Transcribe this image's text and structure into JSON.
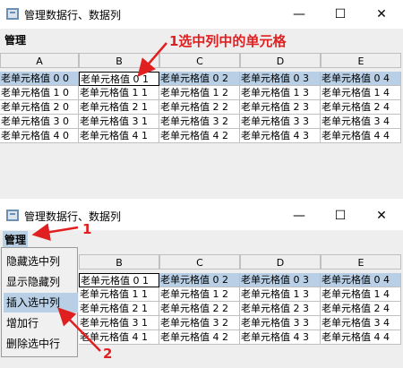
{
  "window1": {
    "title": "管理数据行、数据列",
    "menu": "管理",
    "controls": [
      "—",
      "☐",
      "✕"
    ],
    "columns": [
      "A",
      "B",
      "C",
      "D",
      "E"
    ],
    "rows": [
      [
        "老单元格值 0 0",
        "老单元格值 0 1",
        "老单元格值 0 2",
        "老单元格值 0 3",
        "老单元格值 0 4"
      ],
      [
        "老单元格值 1 0",
        "老单元格值 1 1",
        "老单元格值 1 2",
        "老单元格值 1 3",
        "老单元格值 1 4"
      ],
      [
        "老单元格值 2 0",
        "老单元格值 2 1",
        "老单元格值 2 2",
        "老单元格值 2 3",
        "老单元格值 2 4"
      ],
      [
        "老单元格值 3 0",
        "老单元格值 3 1",
        "老单元格值 3 2",
        "老单元格值 3 3",
        "老单元格值 3 4"
      ],
      [
        "老单元格值 4 0",
        "老单元格值 4 1",
        "老单元格值 4 2",
        "老单元格值 4 3",
        "老单元格值 4 4"
      ]
    ],
    "annotation": "1选中列中的单元格"
  },
  "window2": {
    "title": "管理数据行、数据列",
    "menu": "管理",
    "controls": [
      "—",
      "☐",
      "✕"
    ],
    "columns": [
      "B",
      "C",
      "D",
      "E"
    ],
    "rows": [
      [
        "老单元格值 0 1",
        "老单元格值 0 2",
        "老单元格值 0 3",
        "老单元格值 0 4"
      ],
      [
        "老单元格值 1 1",
        "老单元格值 1 2",
        "老单元格值 1 3",
        "老单元格值 1 4"
      ],
      [
        "老单元格值 2 1",
        "老单元格值 2 2",
        "老单元格值 2 3",
        "老单元格值 2 4"
      ],
      [
        "老单元格值 3 1",
        "老单元格值 3 2",
        "老单元格值 3 3",
        "老单元格值 3 4"
      ],
      [
        "老单元格值 4 1",
        "老单元格值 4 2",
        "老单元格值 4 3",
        "老单元格值 4 4"
      ]
    ],
    "popup_items": [
      "隐藏选中列",
      "显示隐藏列",
      "插入选中列",
      "增加行",
      "删除选中行"
    ],
    "highlighted_item": "插入选中列",
    "annotation_1": "1",
    "annotation_2": "2"
  },
  "colors": {
    "selection": "#b8cfe5",
    "annotation": "#e02020",
    "grid_line": "#c0c0c0"
  }
}
